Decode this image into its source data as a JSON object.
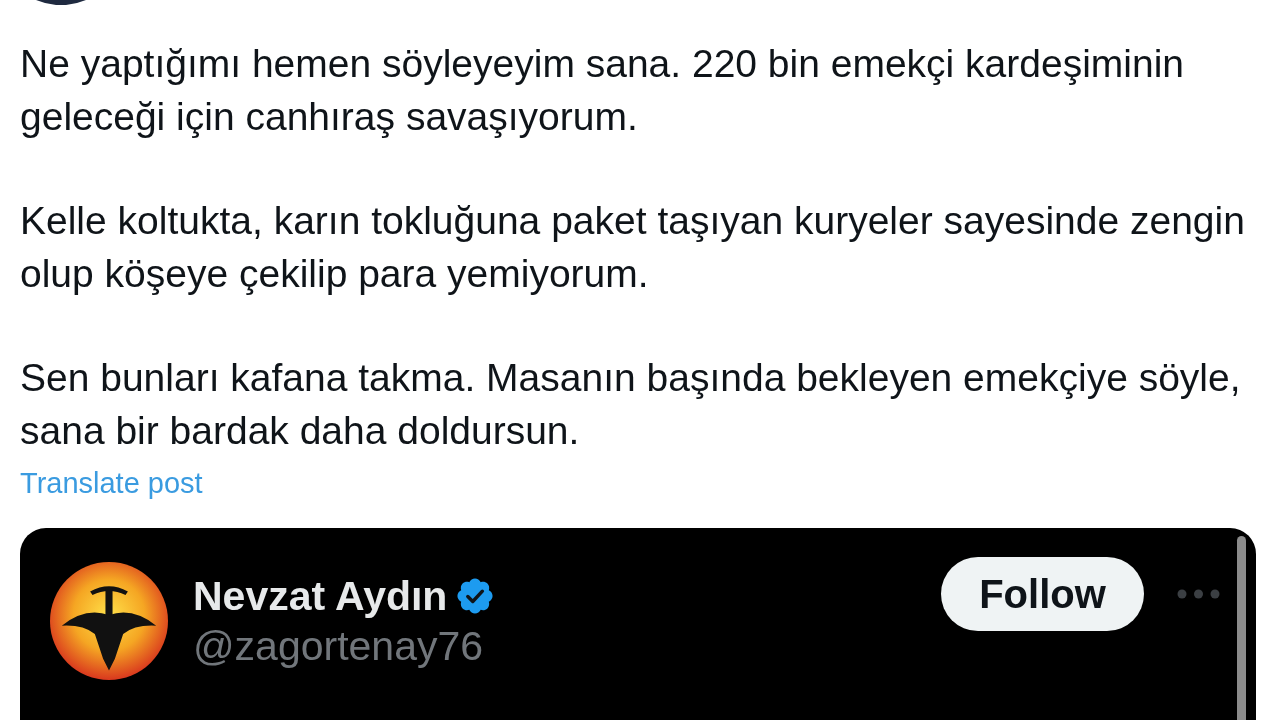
{
  "post": {
    "paragraphs": [
      "Ne yaptığımı hemen söyleyeyim sana. 220 bin emekçi kardeşiminin geleceği için canhıraş savaşıyorum.",
      "Kelle koltukta, karın tokluğuna paket taşıyan kuryeler sayesinde zengin olup köşeye çekilip para yemiyorum.",
      "Sen bunları kafana takma. Masanın başında bekleyen emekçiye söyle, sana bir bardak daha doldursun."
    ],
    "translate_link": "Translate post"
  },
  "quoted_post": {
    "author": {
      "name": "Nevzat Aydın",
      "verified": true,
      "handle": "@zagortenay76"
    },
    "follow_button": "Follow"
  }
}
